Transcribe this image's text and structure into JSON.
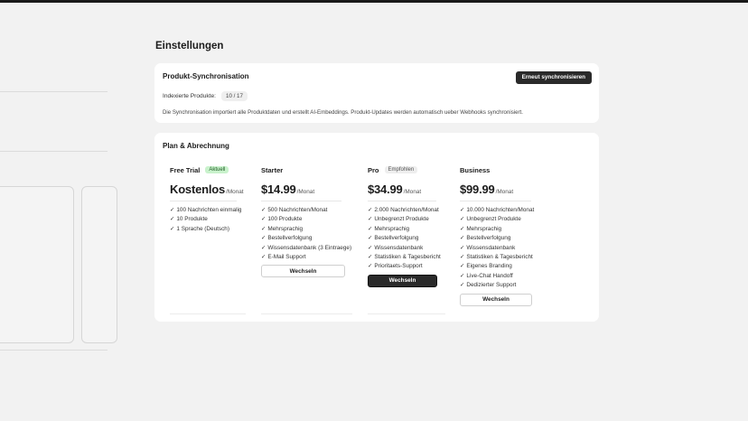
{
  "page_title": "Einstellungen",
  "sync": {
    "title": "Produkt-Synchronisation",
    "button_label": "Erneut synchronisieren",
    "indexed_label": "Indexierte Produkte:",
    "indexed_count": "10 / 17",
    "description": "Die Synchronisation importiert alle Produktdaten und erstellt AI-Embeddings. Produkt-Updates werden automatisch ueber Webhooks synchronisiert."
  },
  "plans_section": {
    "title": "Plan & Abrechnung",
    "check_symbol": "✓",
    "plans": [
      {
        "name": "Free Trial",
        "badge": "Aktuell",
        "price": "Kostenlos",
        "per": "/Monat",
        "features": [
          "100 Nachrichten einmalig",
          "10 Produkte",
          "1 Sprache (Deutsch)"
        ],
        "button": ""
      },
      {
        "name": "Starter",
        "badge": "",
        "price": "$14.99",
        "per": "/Monat",
        "features": [
          "500 Nachrichten/Monat",
          "100 Produkte",
          "Mehrsprachig",
          "Bestellverfolgung",
          "Wissensdatenbank (3 Eintraege)",
          "E-Mail Support"
        ],
        "button": "Wechseln"
      },
      {
        "name": "Pro",
        "badge": "Empfohlen",
        "price": "$34.99",
        "per": "/Monat",
        "features": [
          "2.000 Nachrichten/Monat",
          "Unbegrenzt Produkte",
          "Mehrsprachig",
          "Bestellverfolgung",
          "Wissensdatenbank",
          "Statistiken & Tagesbericht",
          "Prioritaets-Support"
        ],
        "button": "Wechseln"
      },
      {
        "name": "Business",
        "badge": "",
        "price": "$99.99",
        "per": "/Monat",
        "features": [
          "10.000 Nachrichten/Monat",
          "Unbegrenzt Produkte",
          "Mehrsprachig",
          "Bestellverfolgung",
          "Wissensdatenbank",
          "Statistiken & Tagesbericht",
          "Eigenes Branding",
          "Live-Chat Handoff",
          "Dedizierter Support"
        ],
        "button": "Wechseln"
      }
    ]
  }
}
